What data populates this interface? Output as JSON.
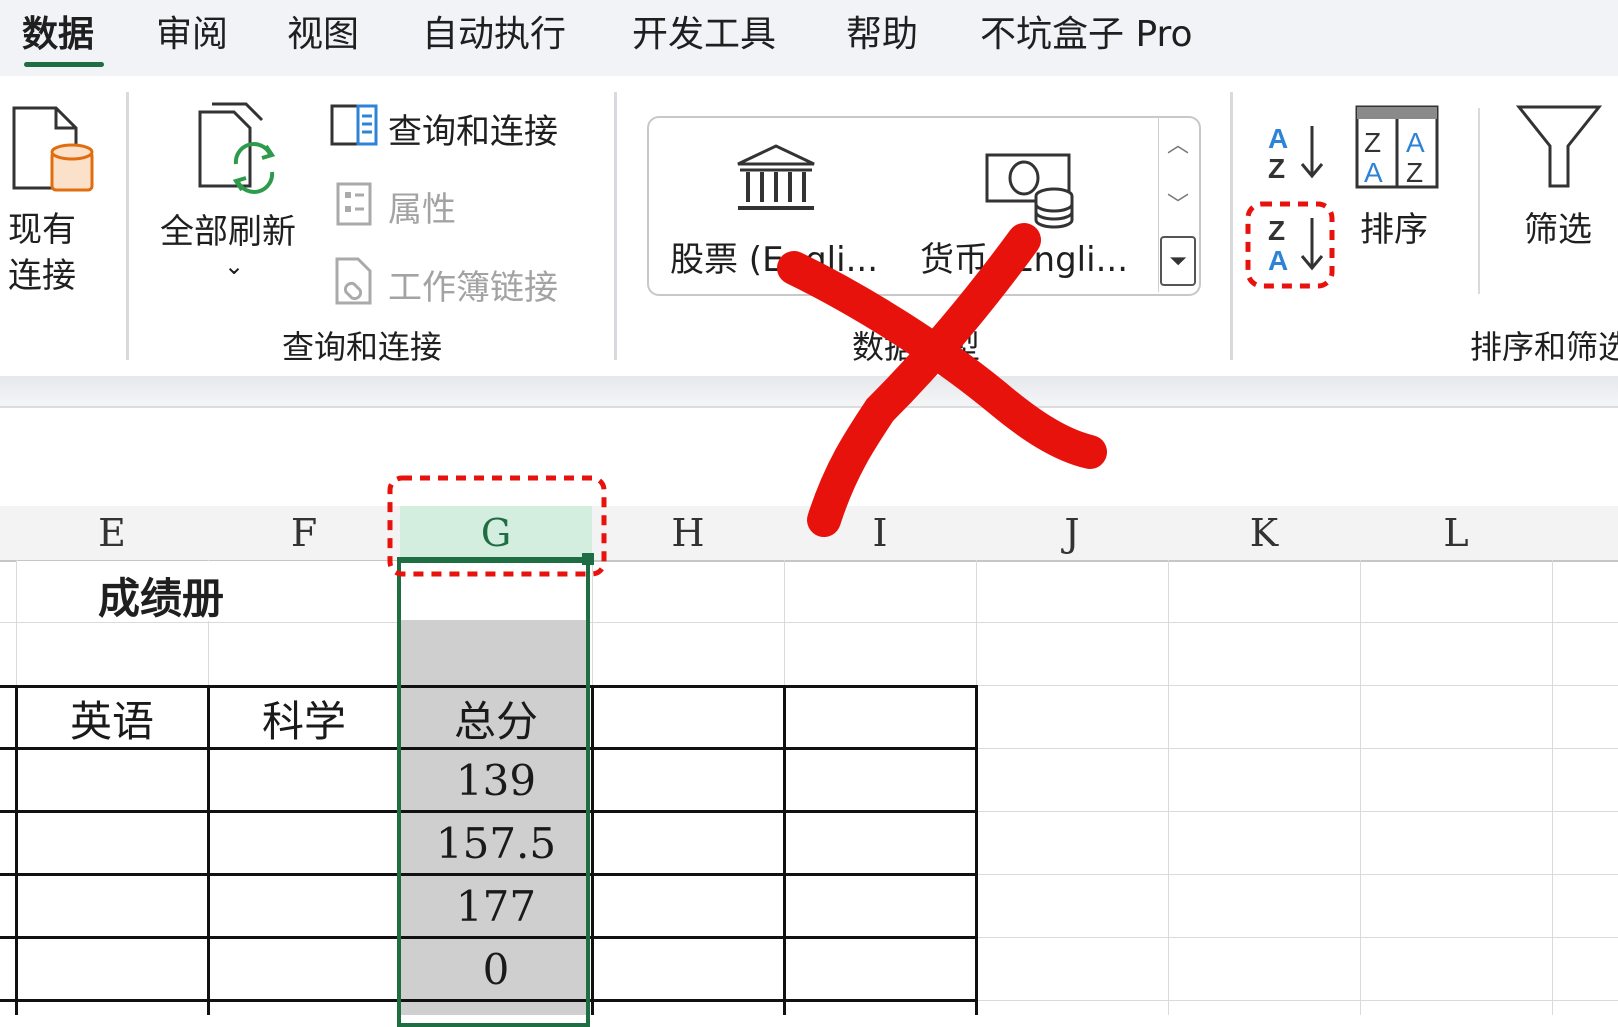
{
  "tabs": [
    "数据",
    "审阅",
    "视图",
    "自动执行",
    "开发工具",
    "帮助",
    "不坑盒子 Pro"
  ],
  "active_tab": "数据",
  "ribbon": {
    "existing_connections": {
      "line1": "现有",
      "line2": "连接"
    },
    "refresh_all": "全部刷新",
    "queries_connections": "查询和连接",
    "properties": "属性",
    "workbook_links": "工作簿链接",
    "group_queries": "查询和连接",
    "stocks": "股票 (Engli...",
    "currencies": "货币 (Engli...",
    "group_datatypes": "数据类型",
    "sort": "排序",
    "filter": "筛选",
    "group_sort_filter": "排序和筛选"
  },
  "sheet": {
    "columns": [
      "E",
      "F",
      "G",
      "H",
      "I",
      "J",
      "K",
      "L"
    ],
    "selected_column": "G",
    "title": "成绩册",
    "headers": [
      "英语",
      "科学",
      "总分"
    ],
    "totals": [
      "139",
      "157.5",
      "177",
      "0"
    ]
  },
  "colors": {
    "accent": "#1f6e43",
    "annotation": "#e8120c",
    "sort_icon_blue": "#2e83d6"
  }
}
